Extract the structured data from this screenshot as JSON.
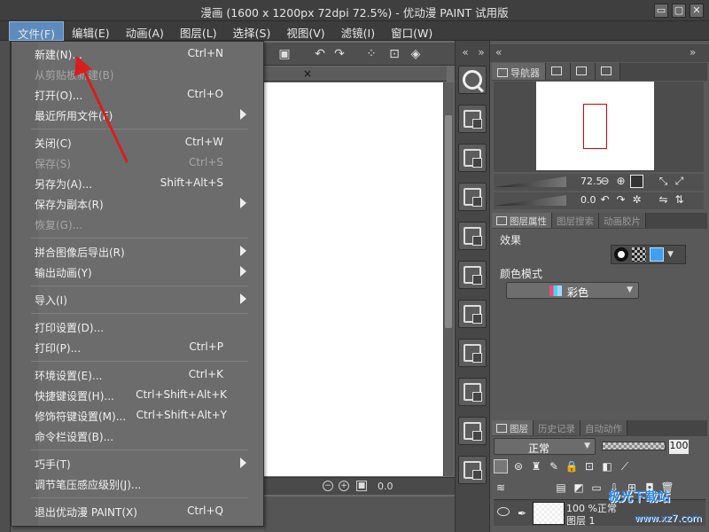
{
  "window": {
    "title": "漫画 (1600 x 1200px 72dpi 72.5%)  - 优动漫 PAINT 试用版",
    "controls": [
      "▭",
      "▢",
      "✕"
    ]
  },
  "menubar": {
    "items": [
      "文件(F)",
      "编辑(E)",
      "动画(A)",
      "图层(L)",
      "选择(S)",
      "视图(V)",
      "滤镜(I)",
      "窗口(W)"
    ]
  },
  "file_menu": {
    "items": [
      {
        "label": "新建(N)...",
        "shortcut": "Ctrl+N"
      },
      {
        "label": "从剪贴板新建(B)",
        "shortcut": ""
      },
      {
        "label": "打开(O)...",
        "shortcut": "Ctrl+O"
      },
      {
        "label": "最近所用文件(F)",
        "shortcut": ""
      },
      {
        "label": "关闭(C)",
        "shortcut": "Ctrl+W"
      },
      {
        "label": "保存(S)",
        "shortcut": "Ctrl+S"
      },
      {
        "label": "另存为(A)...",
        "shortcut": "Shift+Alt+S"
      },
      {
        "label": "保存为副本(R)",
        "shortcut": ""
      },
      {
        "label": "恢复(G)...",
        "shortcut": ""
      },
      {
        "label": "拼合图像后导出(R)",
        "shortcut": ""
      },
      {
        "label": "输出动画(Y)",
        "shortcut": ""
      },
      {
        "label": "导入(I)",
        "shortcut": ""
      },
      {
        "label": "打印设置(D)...",
        "shortcut": ""
      },
      {
        "label": "打印(P)...",
        "shortcut": "Ctrl+P"
      },
      {
        "label": "环境设置(E)...",
        "shortcut": "Ctrl+K"
      },
      {
        "label": "快捷键设置(H)...",
        "shortcut": "Ctrl+Shift+Alt+K"
      },
      {
        "label": "修饰符键设置(M)...",
        "shortcut": "Ctrl+Shift+Alt+Y"
      },
      {
        "label": "命令栏设置(B)...",
        "shortcut": ""
      },
      {
        "label": "巧手(T)",
        "shortcut": ""
      },
      {
        "label": "调节笔压感应级别(J)...",
        "shortcut": ""
      },
      {
        "label": "退出优动漫 PAINT(X)",
        "shortcut": "Ctrl+Q"
      }
    ]
  },
  "canvas": {
    "zoom_readout": "0.0"
  },
  "navigator": {
    "tabs": [
      "导航器"
    ],
    "zoom": "72.5",
    "rotation": "0.0"
  },
  "properties": {
    "tabs": [
      "图层属性",
      "图层搜索",
      "动画胶片"
    ],
    "effect_label": "效果",
    "color_mode_label": "颜色模式",
    "color_mode_value": "彩色"
  },
  "layers": {
    "tabs": [
      "图层",
      "历史记录",
      "自动动作"
    ],
    "blend_mode": "正常",
    "opacity": "100",
    "layer_percent": "100 %",
    "layer_percent_suffix": "正常",
    "layer_name": "图层 1"
  },
  "watermark": {
    "line1": "极光下载站",
    "line2": "www.xz7.com"
  },
  "colors": {
    "menu_highlight": "#5d8bbd",
    "annotation_arrow": "#d81e1e",
    "nav_frame": "#d40000"
  }
}
